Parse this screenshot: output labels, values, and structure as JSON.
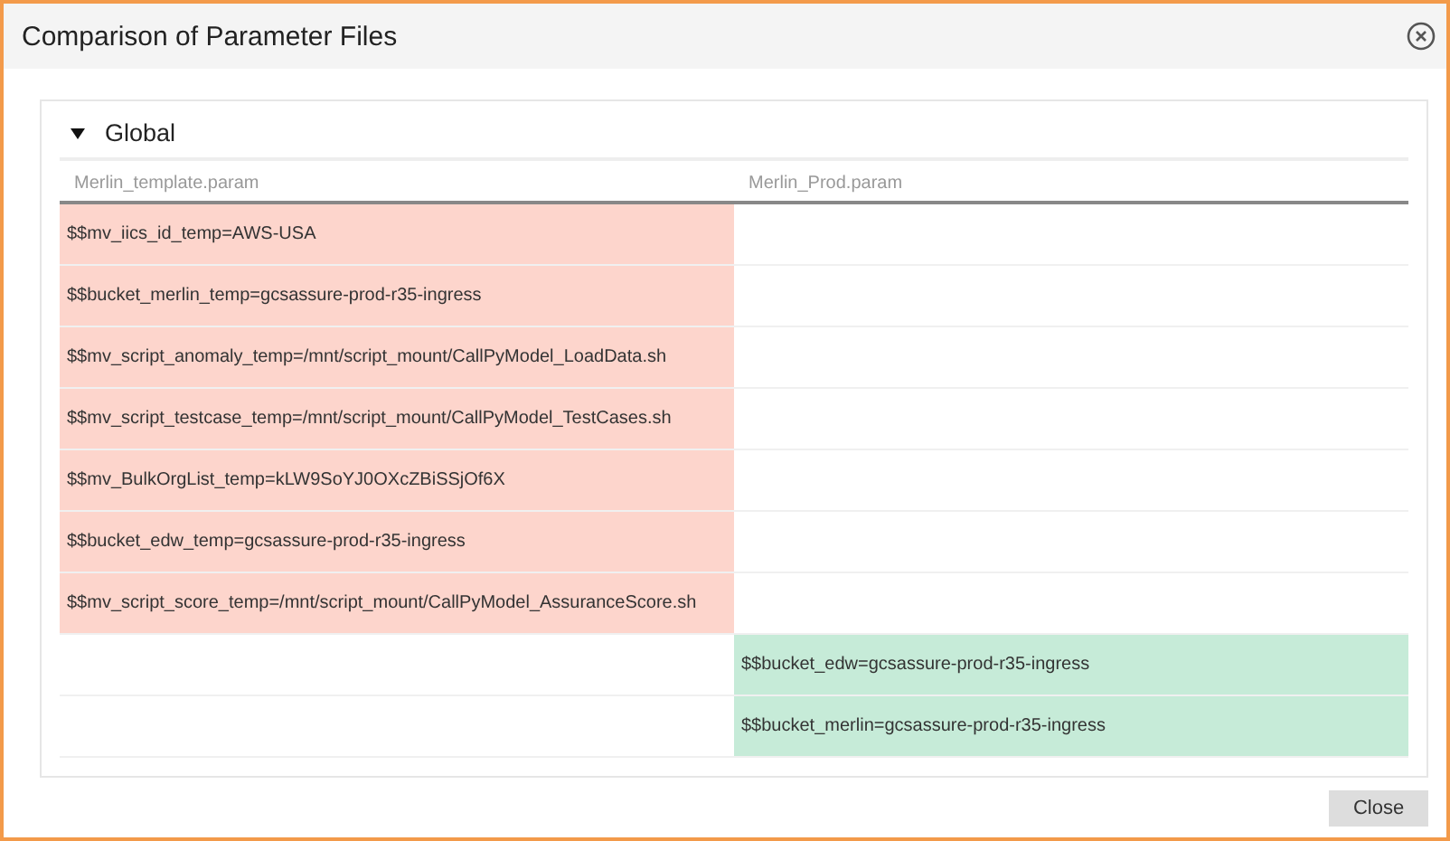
{
  "window": {
    "title": "Comparison of Parameter Files"
  },
  "section": {
    "title": "Global",
    "expanded": true
  },
  "table": {
    "columns": [
      "Merlin_template.param",
      "Merlin_Prod.param"
    ],
    "rows": [
      {
        "kind": "removed",
        "text": "$$mv_iics_id_temp=AWS-USA"
      },
      {
        "kind": "removed",
        "text": "$$bucket_merlin_temp=gcsassure-prod-r35-ingress"
      },
      {
        "kind": "removed",
        "text": "$$mv_script_anomaly_temp=/mnt/script_mount/CallPyModel_LoadData.sh"
      },
      {
        "kind": "removed",
        "text": "$$mv_script_testcase_temp=/mnt/script_mount/CallPyModel_TestCases.sh"
      },
      {
        "kind": "removed",
        "text": "$$mv_BulkOrgList_temp=kLW9SoYJ0OXcZBiSSjOf6X"
      },
      {
        "kind": "removed",
        "text": "$$bucket_edw_temp=gcsassure-prod-r35-ingress"
      },
      {
        "kind": "removed",
        "text": "$$mv_script_score_temp=/mnt/script_mount/CallPyModel_AssuranceScore.sh"
      },
      {
        "kind": "added",
        "text": "$$bucket_edw=gcsassure-prod-r35-ingress"
      },
      {
        "kind": "added",
        "text": "$$bucket_merlin=gcsassure-prod-r35-ingress"
      }
    ]
  },
  "buttons": [
    "Close"
  ]
}
